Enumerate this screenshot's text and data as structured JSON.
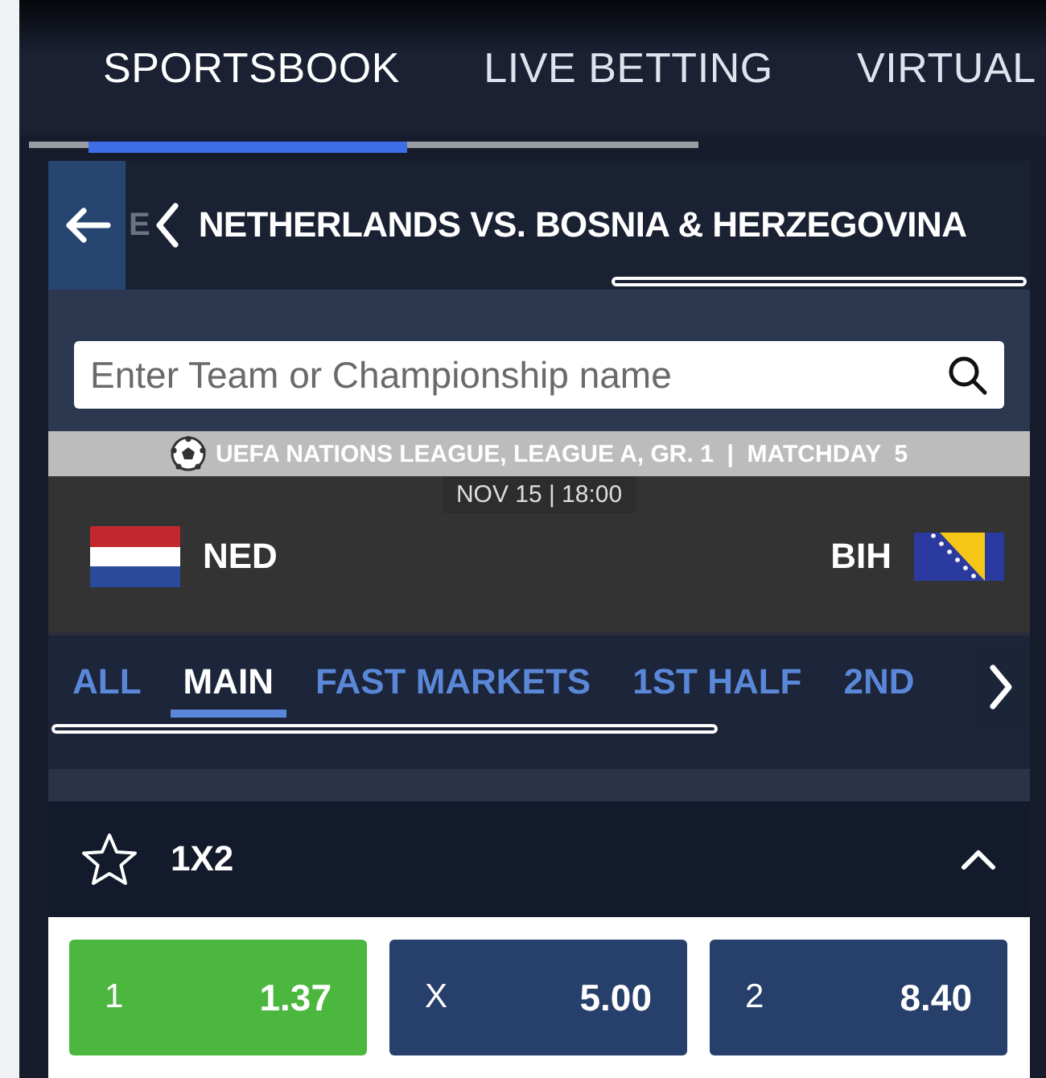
{
  "nav_tabs": [
    {
      "label": "SPORTSBOOK",
      "selected": true
    },
    {
      "label": "LIVE BETTING",
      "selected": false
    },
    {
      "label": "VIRTUAL",
      "selected": false
    }
  ],
  "event_header": {
    "breadcrumb_fragment": "E",
    "title": "NETHERLANDS VS. BOSNIA & HERZEGOVINA"
  },
  "search": {
    "placeholder": "Enter Team or Championship name"
  },
  "match": {
    "competition": "UEFA NATIONS LEAGUE, LEAGUE A, GR. 1  |  MATCHDAY  5",
    "datetime": "NOV 15 | 18:00",
    "home": {
      "code": "NED"
    },
    "away": {
      "code": "BIH"
    }
  },
  "market_tabs": [
    {
      "label": "ALL",
      "selected": false
    },
    {
      "label": "MAIN",
      "selected": true
    },
    {
      "label": "FAST MARKETS",
      "selected": false
    },
    {
      "label": "1ST HALF",
      "selected": false
    },
    {
      "label": "2ND",
      "selected": false
    }
  ],
  "market": {
    "title": "1X2",
    "favorite": false,
    "expanded": true,
    "odds": [
      {
        "label": "1",
        "price": "1.37",
        "selected": true
      },
      {
        "label": "X",
        "price": "5.00",
        "selected": false
      },
      {
        "label": "2",
        "price": "8.40",
        "selected": false
      }
    ]
  }
}
